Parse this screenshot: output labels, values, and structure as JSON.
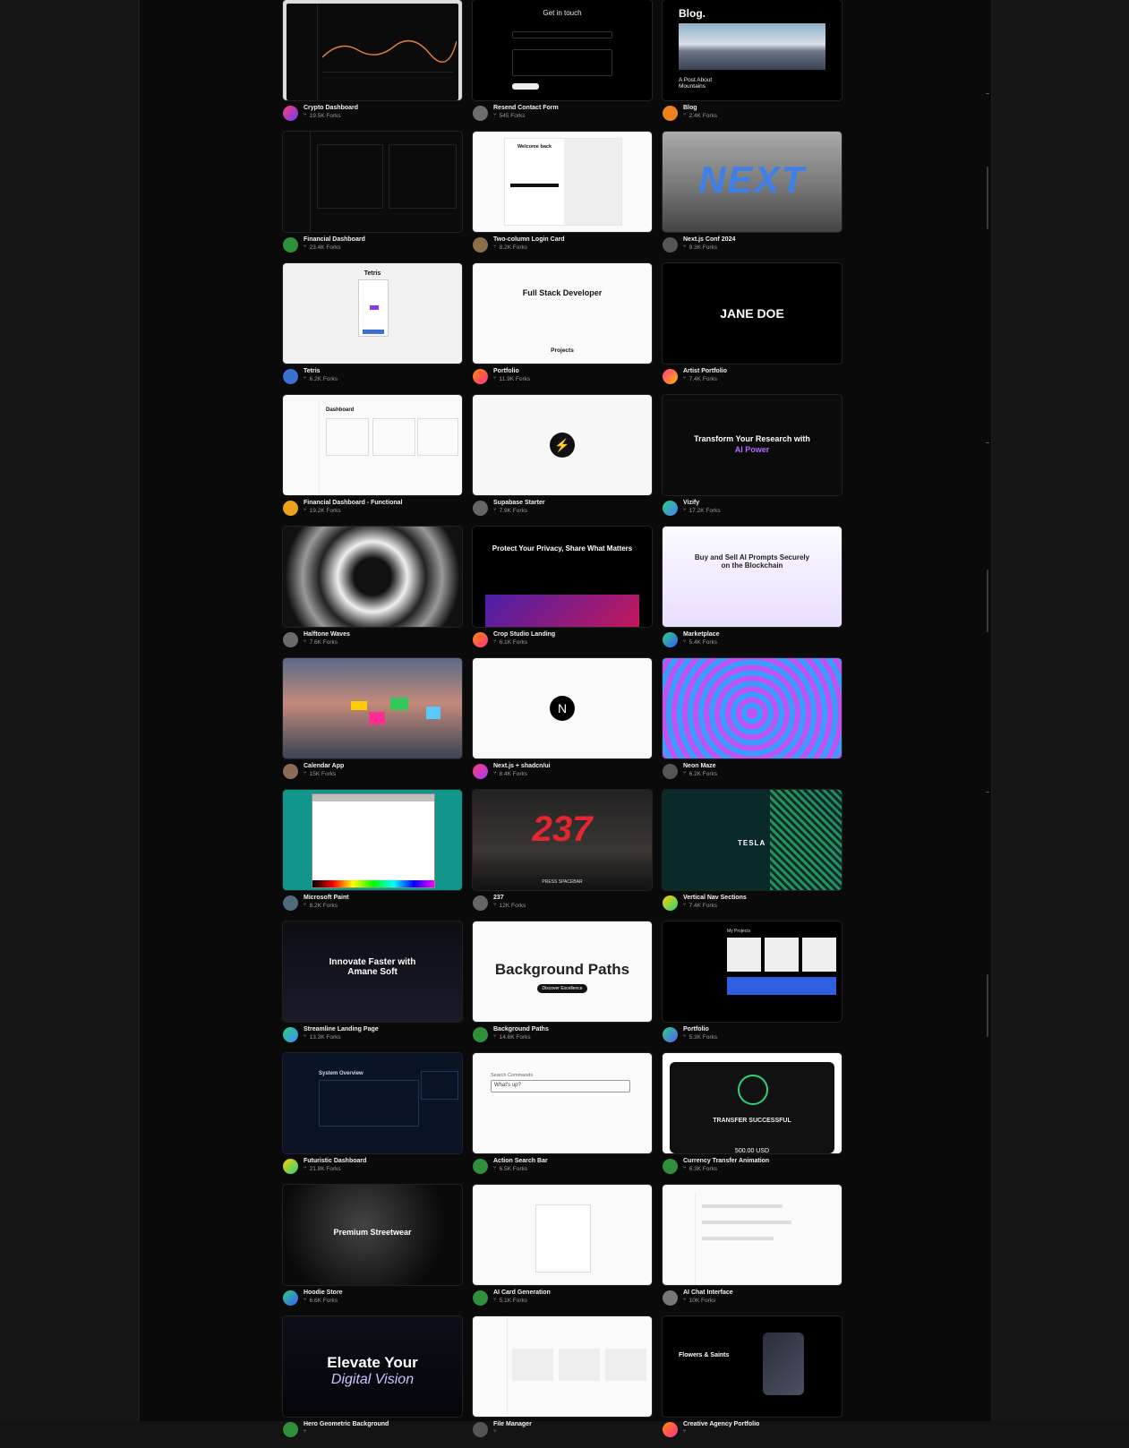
{
  "cards": [
    {
      "title": "Crypto Dashboard",
      "forks": "19.5K Forks",
      "avatar": "linear-gradient(135deg,#ff3d6e,#6b3cff)",
      "thumb": "crypto"
    },
    {
      "title": "Resend Contact Form",
      "forks": "545 Forks",
      "avatar": "#6d6d6d",
      "thumb": "contact",
      "thumb_text": "Get in touch"
    },
    {
      "title": "Blog",
      "forks": "2.4K Forks",
      "avatar": "#e8831d",
      "thumb": "blog",
      "thumb_text": "Blog.",
      "thumb_sub": "A Post About Mountains"
    },
    {
      "title": "Financial Dashboard",
      "forks": "23.4K Forks",
      "avatar": "#2f8f3a",
      "thumb": "findash"
    },
    {
      "title": "Two-column Login Card",
      "forks": "8.2K Forks",
      "avatar": "#8a6f4a",
      "thumb": "login",
      "thumb_text": "Welcome back"
    },
    {
      "title": "Next.js Conf 2024",
      "forks": "9.3K Forks",
      "avatar": "#555",
      "thumb": "nextconf",
      "thumb_text": "NEXT"
    },
    {
      "title": "Tetris",
      "forks": "6.2K Forks",
      "avatar": "#3b6fd1",
      "thumb": "tetris",
      "thumb_text": "Tetris"
    },
    {
      "title": "Portfolio",
      "forks": "11.9K Forks",
      "avatar": "linear-gradient(135deg,#ff8a00,#ff2e92)",
      "thumb": "portfolio",
      "thumb_text": "Full Stack Developer",
      "thumb_sub": "Projects"
    },
    {
      "title": "Artist Portfolio",
      "forks": "7.4K Forks",
      "avatar": "linear-gradient(135deg,#ff3b8d,#ffb100)",
      "thumb": "artist",
      "thumb_text": "JANE DOE"
    },
    {
      "title": "Financial Dashboard - Functional",
      "forks": "19.2K Forks",
      "avatar": "#e9a21a",
      "thumb": "findash2",
      "thumb_text": "Dashboard"
    },
    {
      "title": "Supabase Starter",
      "forks": "7.9K Forks",
      "avatar": "#666",
      "thumb": "supabase"
    },
    {
      "title": "Vizify",
      "forks": "17.2K Forks",
      "avatar": "linear-gradient(135deg,#2ad17a,#4a7bff)",
      "thumb": "vizify",
      "thumb_text": "Transform Your Research with",
      "thumb_sub": "AI Power"
    },
    {
      "title": "Halftone Waves",
      "forks": "7.6K Forks",
      "avatar": "#6a6a6a",
      "thumb": "halftone"
    },
    {
      "title": "Crop Studio Landing",
      "forks": "6.1K Forks",
      "avatar": "linear-gradient(135deg,#ff8a00,#ff2e92)",
      "thumb": "crop",
      "thumb_text": "Protect Your Privacy, Share What Matters"
    },
    {
      "title": "Marketplace",
      "forks": "5.4K Forks",
      "avatar": "linear-gradient(135deg,#2ad17a,#3b5bff)",
      "thumb": "market",
      "thumb_text": "Buy and Sell AI Prompts Securely on the Blockchain"
    },
    {
      "title": "Calendar App",
      "forks": "15K Forks",
      "avatar": "#8b6b55",
      "thumb": "calendar"
    },
    {
      "title": "Next.js + shadcn/ui",
      "forks": "8.4K Forks",
      "avatar": "linear-gradient(135deg,#ff3d6e,#a43cff)",
      "thumb": "nextshad",
      "thumb_text": "N"
    },
    {
      "title": "Neon Maze",
      "forks": "6.2K Forks",
      "avatar": "#555",
      "thumb": "neon"
    },
    {
      "title": "Microsoft Paint",
      "forks": "8.2K Forks",
      "avatar": "#4f6a7a",
      "thumb": "paint"
    },
    {
      "title": "237",
      "forks": "12K Forks",
      "avatar": "#666",
      "thumb": "n237",
      "thumb_text": "237",
      "thumb_sub": "PRESS SPACEBAR"
    },
    {
      "title": "Vertical Nav Sections",
      "forks": "7.4K Forks",
      "avatar": "linear-gradient(135deg,#ffd000,#2ad17a)",
      "thumb": "tesla",
      "thumb_text": "TESLA"
    },
    {
      "title": "Streamline Landing Page",
      "forks": "13.3K Forks",
      "avatar": "linear-gradient(135deg,#2ad17a,#3b8bff)",
      "thumb": "streamline",
      "thumb_text": "Innovate Faster with Amane Soft"
    },
    {
      "title": "Background Paths",
      "forks": "14.6K Forks",
      "avatar": "#2f8f3a",
      "thumb": "bgpaths",
      "thumb_text": "Background Paths",
      "thumb_sub": "Discover Excellence"
    },
    {
      "title": "Portfolio",
      "forks": "5.3K Forks",
      "avatar": "linear-gradient(135deg,#2ad17a,#5b5bff)",
      "thumb": "portfolio2",
      "thumb_text": "My Projects"
    },
    {
      "title": "Futuristic Dashboard",
      "forks": "21.8K Forks",
      "avatar": "linear-gradient(135deg,#ffd000,#2ad17a)",
      "thumb": "futur",
      "thumb_text": "System Overview"
    },
    {
      "title": "Action Search Bar",
      "forks": "6.5K Forks",
      "avatar": "#2f8f3a",
      "thumb": "search",
      "thumb_text": "Search Commands",
      "thumb_sub": "What's up?"
    },
    {
      "title": "Currency Transfer Animation",
      "forks": "6.3K Forks",
      "avatar": "#2f8f3a",
      "thumb": "transfer",
      "thumb_text": "TRANSFER SUCCESSFUL",
      "thumb_sub": "500.00 USD"
    },
    {
      "title": "Hoodie Store",
      "forks": "6.6K Forks",
      "avatar": "linear-gradient(135deg,#2ad17a,#3b5bff)",
      "thumb": "hoodie",
      "thumb_text": "Premium Streetwear"
    },
    {
      "title": "AI Card Generation",
      "forks": "5.1K Forks",
      "avatar": "#2f8f3a",
      "thumb": "aicard"
    },
    {
      "title": "AI Chat Interface",
      "forks": "10K Forks",
      "avatar": "#777",
      "thumb": "aichat"
    },
    {
      "title": "Hero Geometric Background",
      "forks": "",
      "avatar": "#2f8f3a",
      "thumb": "hero",
      "thumb_text": "Elevate Your",
      "thumb_sub": "Digital Vision"
    },
    {
      "title": "File Manager",
      "forks": "",
      "avatar": "#555",
      "thumb": "filemgr"
    },
    {
      "title": "Creative Agency Portfolio",
      "forks": "",
      "avatar": "linear-gradient(135deg,#ff8a00,#ff2e92)",
      "thumb": "agency",
      "thumb_text": "Flowers & Saints"
    }
  ],
  "icons": {
    "fork": "fork-icon"
  }
}
